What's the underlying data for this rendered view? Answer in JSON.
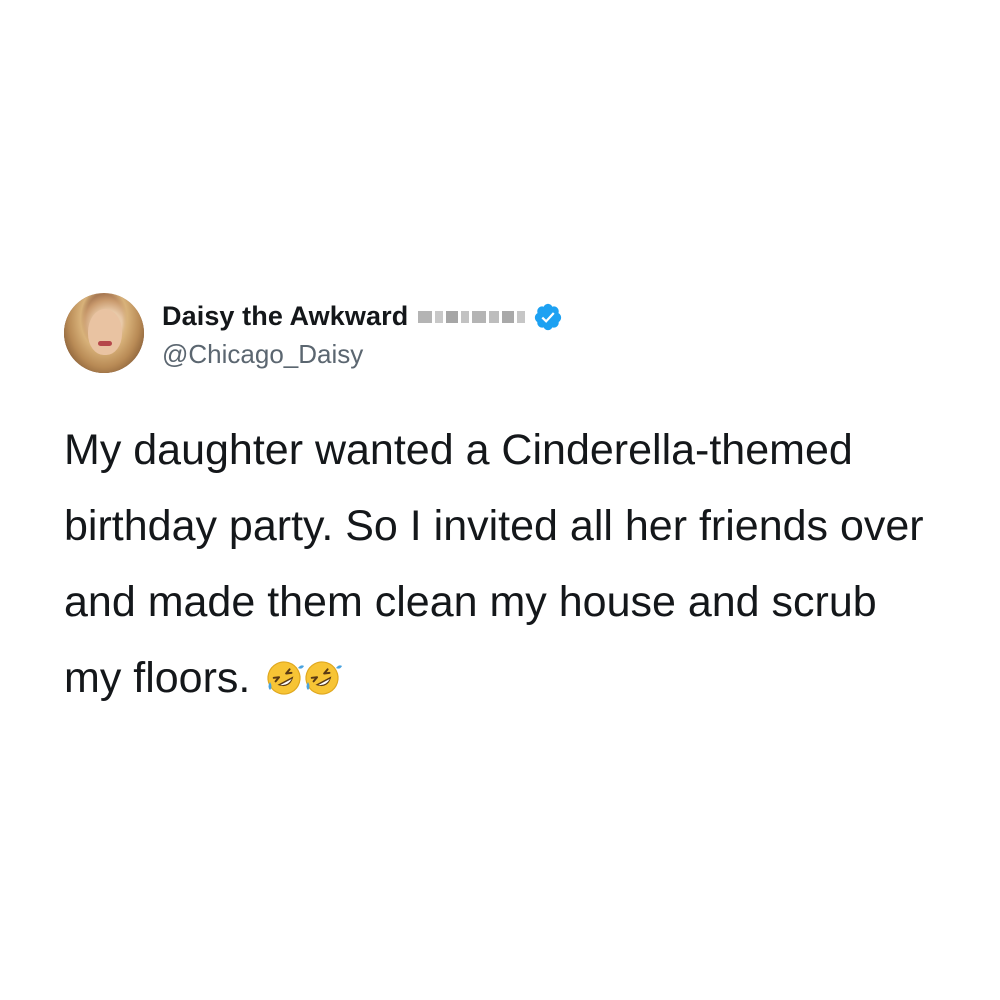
{
  "tweet": {
    "display_name": "Daisy the Awkward",
    "handle": "@Chicago_Daisy",
    "text": "My daughter wanted a Cinderella-themed birthday party. So I invited all her friends over and made them clean my house and scrub my floors.",
    "emojis": [
      "rolling-on-floor-laughing",
      "rolling-on-floor-laughing"
    ],
    "verified": true,
    "colors": {
      "verified_badge": "#1da1f2",
      "text": "#14171a",
      "handle": "#5b6670"
    }
  }
}
